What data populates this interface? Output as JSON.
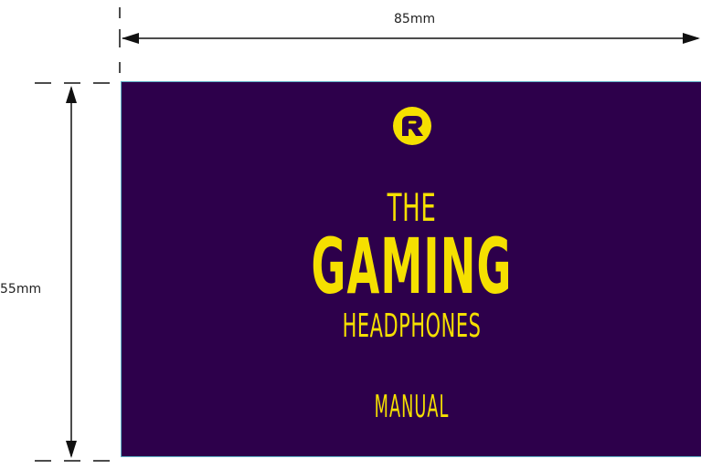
{
  "dimensions": {
    "width_label": "85mm",
    "height_label": "55mm"
  },
  "card": {
    "logo_icon": "brand-r-logo-icon",
    "title_line1": "THE",
    "title_line2": "GAMING",
    "title_line3": "HEADPHONES",
    "subtitle": "MANUAL"
  },
  "colors": {
    "card_background": "#2d004b",
    "accent_yellow": "#f5e000",
    "trim_border": "#5fb0c6",
    "dimension_lines": "#111111"
  }
}
